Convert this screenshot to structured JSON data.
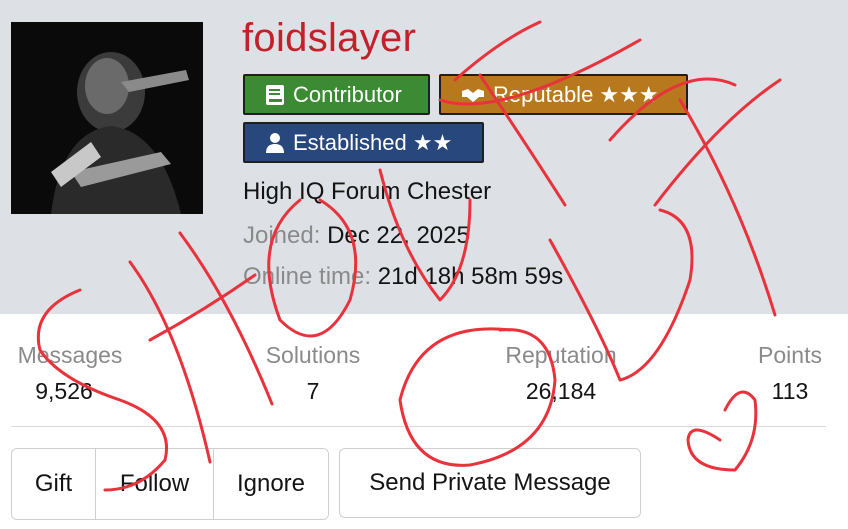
{
  "profile": {
    "username": "foidslayer",
    "title": "High IQ Forum Chester",
    "joined_label": "Joined:",
    "joined_value": "Dec 22, 2025",
    "online_label": "Online time:",
    "online_value": "21d 18h 58m 59s",
    "avatar_icon": "soldier-with-pistol-avatar"
  },
  "badges": [
    {
      "label": "Contributor",
      "icon": "book-icon",
      "color": "#3c8a33"
    },
    {
      "label": "Reputable ★★★",
      "icon": "handshake-icon",
      "color": "#b8791e"
    },
    {
      "label": "Established ★★",
      "icon": "user-icon",
      "color": "#27477d"
    }
  ],
  "stats": [
    {
      "label": "Messages",
      "value": "9,526"
    },
    {
      "label": "Solutions",
      "value": "7"
    },
    {
      "label": "Reputation",
      "value": "26,184"
    },
    {
      "label": "Points",
      "value": "113"
    }
  ],
  "actions": {
    "gift": "Gift",
    "follow": "Follow",
    "ignore": "Ignore",
    "send_pm": "Send Private Message"
  },
  "annotation": {
    "color": "#e8323c"
  }
}
